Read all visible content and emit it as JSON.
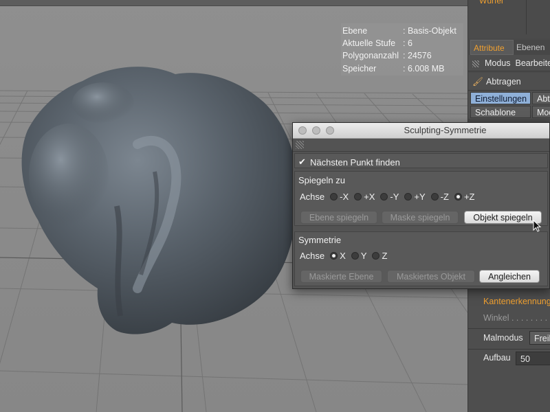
{
  "viewport": {
    "hud": [
      {
        "key": "Ebene",
        "value": ": Basis-Objekt"
      },
      {
        "key": "Aktuelle Stufe",
        "value": ": 6"
      },
      {
        "key": "Polygonanzahl",
        "value": ": 24576"
      },
      {
        "key": "Speicher",
        "value": ": 6.008 MB"
      }
    ]
  },
  "panel": {
    "object_name": "Würfel",
    "tabs": [
      "Attribute",
      "Ebenen"
    ],
    "modus_label": "Modus",
    "bearbeiten_label": "Bearbeiten",
    "tool_name": "Abtragen",
    "buttons_row1": [
      "Einstellungen",
      "Abtragen"
    ],
    "buttons_row2": [
      "Schablone",
      "Modifikatoren"
    ],
    "kantenerkennung_label": "Kantenerkennung",
    "winkel_label": "Winkel . . . . . . . . . . .",
    "malmodus_label": "Malmodus",
    "malmodus_value": "Freihand",
    "aufbau_label": "Aufbau",
    "aufbau_value": "50"
  },
  "dialog": {
    "title": "Sculpting-Symmetrie",
    "find_nearest": {
      "label": "Nächsten Punkt finden",
      "checked": true
    },
    "mirror_group": {
      "title": "Spiegeln zu",
      "axis_label": "Achse",
      "options": [
        "-X",
        "+X",
        "-Y",
        "+Y",
        "-Z",
        "+Z"
      ],
      "selected": "+Z",
      "buttons": [
        "Ebene spiegeln",
        "Maske spiegeln",
        "Objekt spiegeln"
      ]
    },
    "symmetry_group": {
      "title": "Symmetrie",
      "axis_label": "Achse",
      "options": [
        "X",
        "Y",
        "Z"
      ],
      "selected": "X",
      "buttons": [
        "Maskierte Ebene",
        "Maskiertes Objekt",
        "Angleichen"
      ]
    }
  },
  "colors": {
    "accent_orange": "#f0a030",
    "selected_button": "#8fb0d8",
    "viewport_bg": "#8e8e8e",
    "panel_bg": "#4a4a4a",
    "dialog_bg": "#535353"
  }
}
